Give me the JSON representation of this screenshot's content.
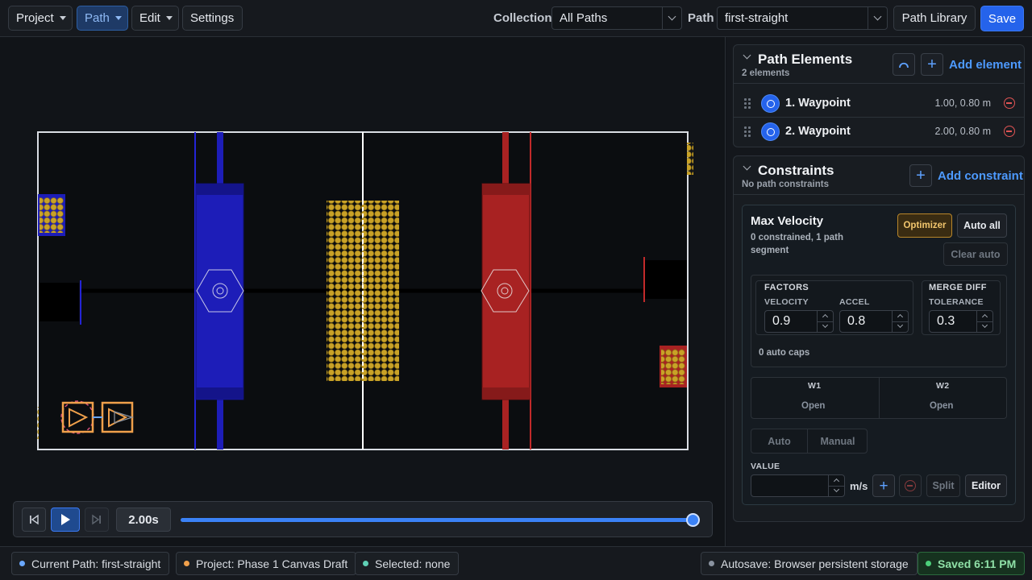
{
  "topbar": {
    "menus": [
      {
        "label": "Project"
      },
      {
        "label": "Path"
      },
      {
        "label": "Edit"
      }
    ],
    "settings_label": "Settings",
    "collection_label": "Collection",
    "collection_value": "All Paths",
    "path_label": "Path",
    "path_value": "first-straight",
    "library_label": "Path Library",
    "save_label": "Save"
  },
  "timeline": {
    "time": "2.00s",
    "progress": 1.0
  },
  "path_elements": {
    "title": "Path Elements",
    "subtitle": "2 elements",
    "add_label": "Add element",
    "items": [
      {
        "label": "1. Waypoint",
        "coords": "1.00, 0.80 m"
      },
      {
        "label": "2. Waypoint",
        "coords": "2.00, 0.80 m"
      }
    ]
  },
  "constraints": {
    "title": "Constraints",
    "subtitle": "No path constraints",
    "add_label": "Add constraint",
    "max_velocity": {
      "title": "Max Velocity",
      "summary": "0 constrained, 1 path segment",
      "optimizer_label": "Optimizer",
      "auto_all_label": "Auto all",
      "clear_auto_label": "Clear auto",
      "factors_title": "FACTORS",
      "velocity_label": "VELOCITY",
      "velocity_value": "0.9",
      "accel_label": "ACCEL",
      "accel_value": "0.8",
      "merge_title": "MERGE DIFF",
      "tolerance_label": "TOLERANCE",
      "tolerance_value": "0.3",
      "auto_caps": "0 auto caps",
      "w1_label": "W1",
      "w1_value": "Open",
      "w2_label": "W2",
      "w2_value": "Open",
      "mode_auto": "Auto",
      "mode_manual": "Manual",
      "value_label": "VALUE",
      "value_input": "",
      "unit": "m/s",
      "split_label": "Split",
      "editor_label": "Editor"
    }
  },
  "status": {
    "current_path": "Current Path: first-straight",
    "project": "Project: Phase 1 Canvas Draft",
    "selected": "Selected: none",
    "autosave": "Autosave: Browser persistent storage",
    "saved": "Saved 6:11 PM",
    "colors": {
      "current": "#6aa8ff",
      "project": "#f0a04b",
      "selected": "#5fd0b5",
      "autosave": "#8a93a0",
      "saved": "#4cd07a"
    }
  },
  "field": {
    "blue": "#1d1db8",
    "red": "#a82222",
    "fuel": "#c9a227",
    "robot": "#f0a04b"
  }
}
